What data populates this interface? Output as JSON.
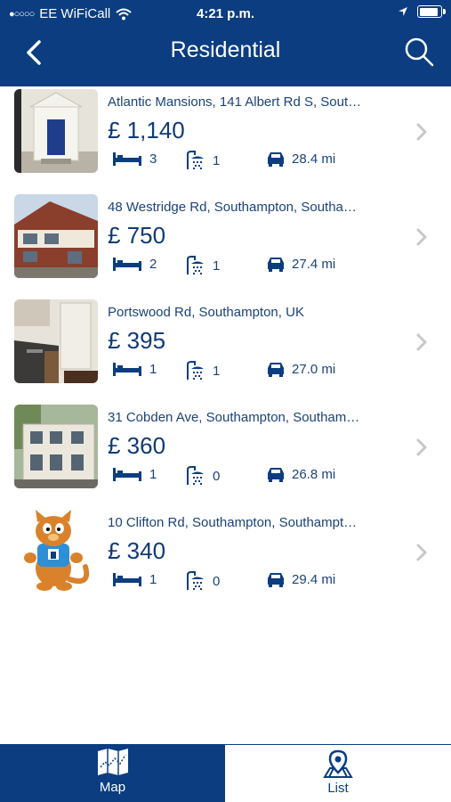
{
  "status_bar": {
    "carrier": "EE WiFiCall",
    "time": "4:21 p.m."
  },
  "header": {
    "title": "Residential",
    "back_icon": "chevron-left-icon",
    "search_icon": "search-icon"
  },
  "listings": [
    {
      "address": "Atlantic Mansions, 141 Albert Rd S, Sout…",
      "price": "£ 1,140",
      "beds": "3",
      "baths": "1",
      "distance": "28.4 mi"
    },
    {
      "address": "48 Westridge Rd, Southampton, Southa…",
      "price": "£ 750",
      "beds": "2",
      "baths": "1",
      "distance": "27.4 mi"
    },
    {
      "address": "Portswood Rd, Southampton, UK",
      "price": "£ 395",
      "beds": "1",
      "baths": "1",
      "distance": "27.0 mi"
    },
    {
      "address": "31 Cobden Ave, Southampton, Southam…",
      "price": "£ 360",
      "beds": "1",
      "baths": "0",
      "distance": "26.8 mi"
    },
    {
      "address": "10 Clifton Rd, Southampton, Southampt…",
      "price": "£ 340",
      "beds": "1",
      "baths": "0",
      "distance": "29.4 mi"
    }
  ],
  "tabs": [
    {
      "label": "Map",
      "icon": "map-icon",
      "active": false
    },
    {
      "label": "List",
      "icon": "map-pin-icon",
      "active": true
    }
  ],
  "colors": {
    "brand": "#0b3d80",
    "text": "#1b427a",
    "chevron": "#c7c7cc"
  }
}
